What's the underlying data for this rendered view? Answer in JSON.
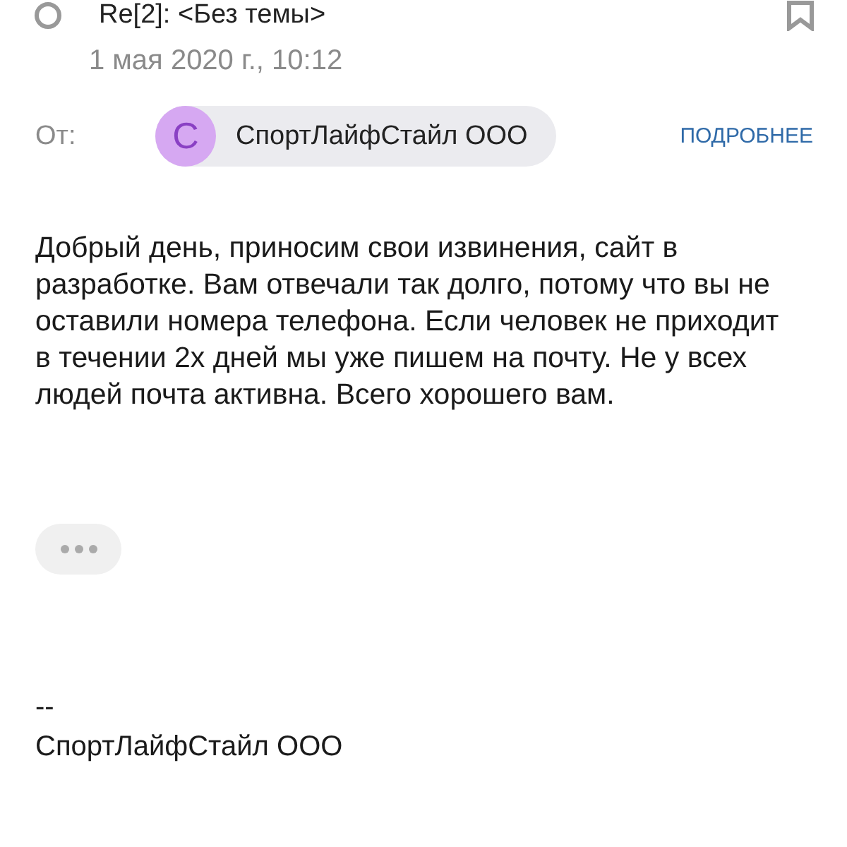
{
  "subject": "Re[2]: <Без темы>",
  "date": "1 мая 2020 г., 10:12",
  "from": {
    "label": "От:",
    "avatar_letter": "С",
    "name": "СпортЛайфСтайл ООО",
    "details_link": "ПОДРОБНЕЕ"
  },
  "body": "Добрый день, приносим свои извинения, сайт в разработке. Вам отвечали так долго, потому что вы не оставили номера телефона. Если человек не приходит в течении 2х дней мы уже пишем на почту. Не у всех людей почта активна. Всего хорошего вам.",
  "signature": [
    "--",
    "СпортЛайфСтайл ООО"
  ]
}
